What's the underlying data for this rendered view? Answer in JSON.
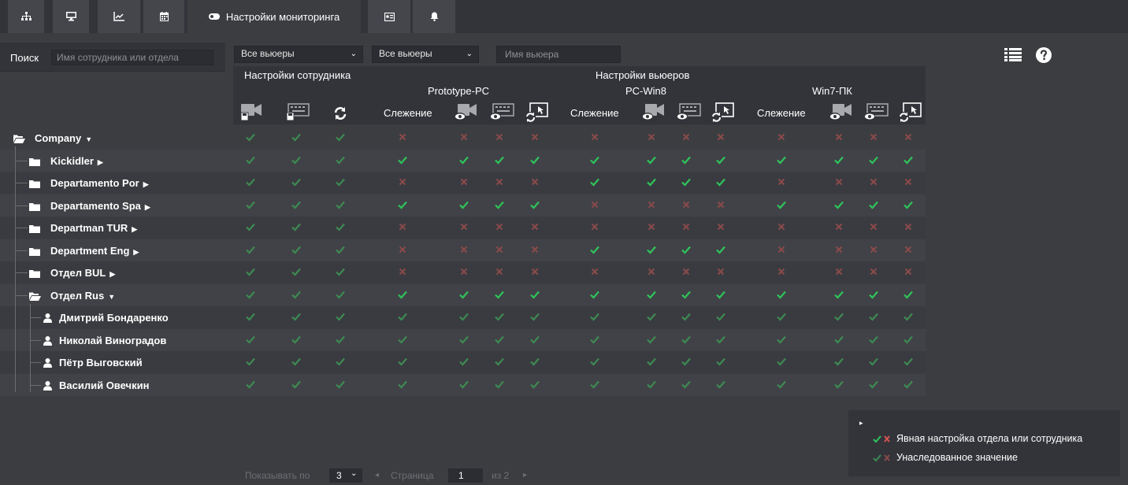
{
  "colors": {
    "ok": "#2ec45a",
    "ok_dim": "#3d8a52",
    "no": "#d9534f",
    "no_dim": "#8a4a4a"
  },
  "tabs": [
    {
      "icon": "sitemap-icon"
    },
    {
      "icon": "desktop-icon"
    },
    {
      "icon": "chart-icon"
    },
    {
      "icon": "calendar-icon"
    },
    {
      "icon": "toggle-icon",
      "label": "Настройки мониторинга",
      "active": true
    },
    {
      "icon": "id-card-icon"
    },
    {
      "icon": "bell-icon"
    }
  ],
  "search": {
    "label": "Поиск",
    "placeholder": "Имя сотрудника или отдела"
  },
  "filters": {
    "viewers1": "Все вьюеры",
    "viewers2": "Все вьюеры",
    "viewer_name_placeholder": "Имя вьюера"
  },
  "header": {
    "employee_settings": "Настройки сотрудника",
    "viewer_settings": "Настройки вьюеров",
    "viewers": [
      "Prototype-PC",
      "PC-Win8",
      "Win7-ПК"
    ],
    "tracking": "Слежение"
  },
  "tree": [
    {
      "label": "Company",
      "type": "folder-open",
      "caret": "down",
      "cells": [
        "ok_d",
        "ok_d",
        "ok_d",
        "no_d",
        "no_d",
        "no_d",
        "no_d",
        "no_d",
        "no_d",
        "no_d",
        "no_d",
        "no_d",
        "no_d",
        "no_d",
        "no_d"
      ]
    },
    {
      "label": "Kickidler",
      "type": "folder",
      "caret": "right",
      "cells": [
        "ok_d",
        "ok_d",
        "ok_d",
        "ok",
        "ok",
        "ok",
        "ok",
        "ok",
        "ok",
        "ok",
        "ok",
        "ok",
        "ok",
        "ok",
        "ok"
      ]
    },
    {
      "label": "Departamento Por",
      "type": "folder",
      "caret": "right",
      "cells": [
        "ok_d",
        "ok_d",
        "ok_d",
        "no_d",
        "no_d",
        "no_d",
        "no_d",
        "ok",
        "ok",
        "ok",
        "ok",
        "no_d",
        "no_d",
        "no_d",
        "no_d"
      ]
    },
    {
      "label": "Departamento Spa",
      "type": "folder",
      "caret": "right",
      "cells": [
        "ok_d",
        "ok_d",
        "ok_d",
        "ok",
        "ok",
        "ok",
        "ok",
        "no_d",
        "no_d",
        "no_d",
        "no_d",
        "ok",
        "ok",
        "ok",
        "ok"
      ]
    },
    {
      "label": "Departman TUR",
      "type": "folder",
      "caret": "right",
      "cells": [
        "ok_d",
        "ok_d",
        "ok_d",
        "no_d",
        "no_d",
        "no_d",
        "no_d",
        "no_d",
        "no_d",
        "no_d",
        "no_d",
        "no_d",
        "no_d",
        "no_d",
        "no_d"
      ]
    },
    {
      "label": "Department Eng",
      "type": "folder",
      "caret": "right",
      "cells": [
        "ok_d",
        "ok_d",
        "ok_d",
        "no_d",
        "no_d",
        "no_d",
        "no_d",
        "ok",
        "ok",
        "ok",
        "ok",
        "no_d",
        "no_d",
        "no_d",
        "no_d"
      ]
    },
    {
      "label": "Отдел BUL",
      "type": "folder",
      "caret": "right",
      "cells": [
        "ok_d",
        "ok_d",
        "ok_d",
        "no_d",
        "no_d",
        "no_d",
        "no_d",
        "no_d",
        "no_d",
        "no_d",
        "no_d",
        "no_d",
        "no_d",
        "no_d",
        "no_d"
      ]
    },
    {
      "label": "Отдел Rus",
      "type": "folder-open",
      "caret": "down",
      "cells": [
        "ok_d",
        "ok_d",
        "ok_d",
        "ok",
        "ok",
        "ok",
        "ok",
        "ok",
        "ok",
        "ok",
        "ok",
        "ok",
        "ok",
        "ok",
        "ok"
      ]
    },
    {
      "label": "Дмитрий Бондаренко",
      "type": "user",
      "cells": [
        "ok_d",
        "ok_d",
        "ok_d",
        "ok_d",
        "ok_d",
        "ok_d",
        "ok_d",
        "ok_d",
        "ok_d",
        "ok_d",
        "ok_d",
        "ok_d",
        "ok_d",
        "ok_d",
        "ok_d"
      ]
    },
    {
      "label": "Николай Виноградов",
      "type": "user",
      "cells": [
        "ok_d",
        "ok_d",
        "ok_d",
        "ok_d",
        "ok_d",
        "ok_d",
        "ok_d",
        "ok_d",
        "ok_d",
        "ok_d",
        "ok_d",
        "ok_d",
        "ok_d",
        "ok_d",
        "ok_d"
      ]
    },
    {
      "label": "Пётр Выговский",
      "type": "user",
      "cells": [
        "ok_d",
        "ok_d",
        "ok_d",
        "ok_d",
        "ok_d",
        "ok_d",
        "ok_d",
        "ok_d",
        "ok_d",
        "ok_d",
        "ok_d",
        "ok_d",
        "ok_d",
        "ok_d",
        "ok_d"
      ]
    },
    {
      "label": "Василий Овечкин",
      "type": "user",
      "cells": [
        "ok_d",
        "ok_d",
        "ok_d",
        "ok_d",
        "ok_d",
        "ok_d",
        "ok_d",
        "ok_d",
        "ok_d",
        "ok_d",
        "ok_d",
        "ok_d",
        "ok_d",
        "ok_d",
        "ok_d"
      ]
    }
  ],
  "pager": {
    "show_label": "Показывать по",
    "per_page": "3",
    "page_label": "Страница",
    "page": "1",
    "of_label": "из 2"
  },
  "legend": {
    "explicit": "Явная настройка отдела или сотрудника",
    "inherited": "Унаследованное значение"
  }
}
